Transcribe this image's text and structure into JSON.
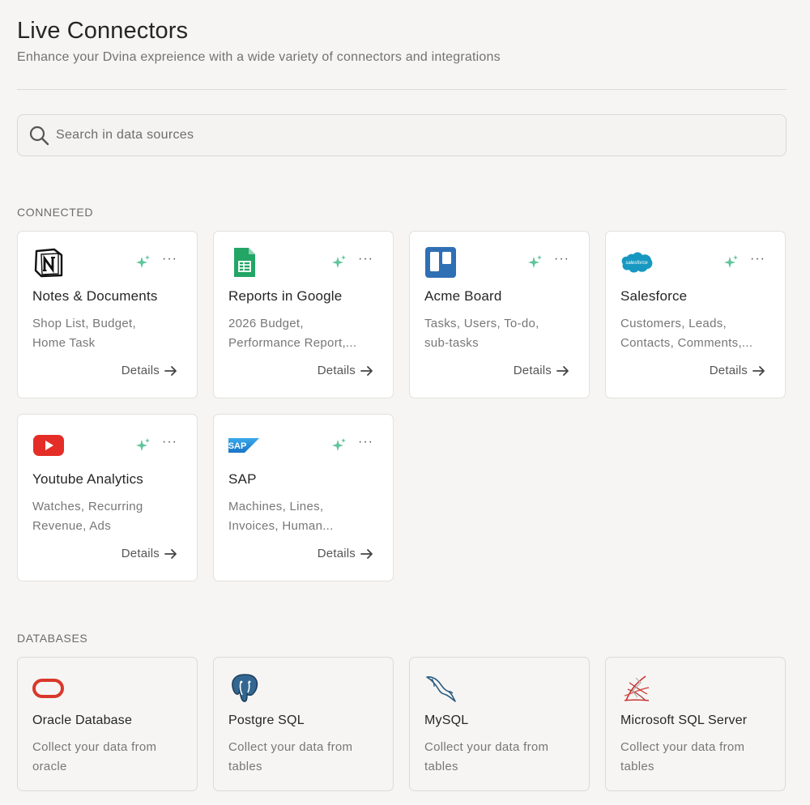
{
  "header": {
    "title": "Live Connectors",
    "subtitle": "Enhance your Dvina expreience with a wide variety of connectors and integrations"
  },
  "search": {
    "placeholder": "Search in data sources",
    "value": ""
  },
  "connected": {
    "label": "CONNECTED",
    "details_label": "Details",
    "cards": [
      {
        "name": "Notes & Documents",
        "desc1": "Shop List, Budget,",
        "desc2": "Home Task",
        "icon": "notion-icon"
      },
      {
        "name": "Reports in Google",
        "desc1": "2026 Budget,",
        "desc2": "Performance Report,...",
        "icon": "google-sheets-icon"
      },
      {
        "name": "Acme Board",
        "desc1": "Tasks, Users, To-do,",
        "desc2": "sub-tasks",
        "icon": "trello-icon"
      },
      {
        "name": "Salesforce",
        "desc1": "Customers, Leads,",
        "desc2": "Contacts, Comments,...",
        "icon": "salesforce-icon",
        "logo_text": "salesforce"
      },
      {
        "name": "Youtube Analytics",
        "desc1": "Watches, Recurring",
        "desc2": "Revenue, Ads",
        "icon": "youtube-icon"
      },
      {
        "name": "SAP",
        "desc1": "Machines, Lines,",
        "desc2": "Invoices, Human...",
        "icon": "sap-icon",
        "logo_text": "SAP"
      }
    ]
  },
  "databases": {
    "label": "DATABASES",
    "cards": [
      {
        "name": "Oracle Database",
        "desc1": "Collect your data from",
        "desc2": "oracle",
        "icon": "oracle-icon"
      },
      {
        "name": "Postgre SQL",
        "desc1": "Collect your data from",
        "desc2": "tables",
        "icon": "postgresql-icon"
      },
      {
        "name": "MySQL",
        "desc1": "Collect your data from",
        "desc2": "tables",
        "icon": "mysql-icon"
      },
      {
        "name": "Microsoft SQL Server",
        "desc1": "Collect your data from",
        "desc2": "tables",
        "icon": "sql-server-icon"
      }
    ]
  },
  "colors": {
    "background": "#f6f5f4",
    "sparkle": "#5fc49a",
    "youtube": "#e52d27",
    "trello": "#2f6fb4",
    "sheets": "#23a566",
    "salesforce": "#1798c1",
    "sap": "#1a8fd8",
    "oracle": "#d9382b"
  }
}
